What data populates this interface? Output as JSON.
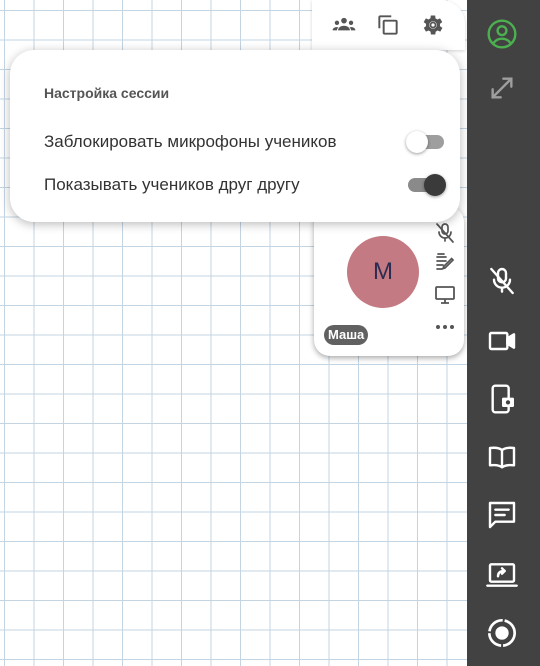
{
  "toolbar": {
    "buttons": [
      {
        "icon": "group-icon"
      },
      {
        "icon": "copy-icon"
      },
      {
        "icon": "gear-icon"
      }
    ]
  },
  "settings": {
    "title": "Настройка сессии",
    "options": [
      {
        "label": "Заблокировать микрофоны учеников",
        "enabled": false
      },
      {
        "label": "Показывать учеников друг другу",
        "enabled": true
      }
    ]
  },
  "participant": {
    "initial": "М",
    "name": "Маша",
    "avatar_color": "#c47a82"
  },
  "sidebar": {
    "accent_color": "#4caf50",
    "background_color": "#424242",
    "buttons": [
      {
        "icon": "account-circle-icon"
      },
      {
        "icon": "expand-icon"
      },
      {
        "icon": "mic-off-icon"
      },
      {
        "icon": "video-camera-icon"
      },
      {
        "icon": "phone-camera-icon"
      },
      {
        "icon": "book-icon"
      },
      {
        "icon": "chat-icon"
      },
      {
        "icon": "screen-share-icon"
      },
      {
        "icon": "record-icon"
      }
    ]
  }
}
